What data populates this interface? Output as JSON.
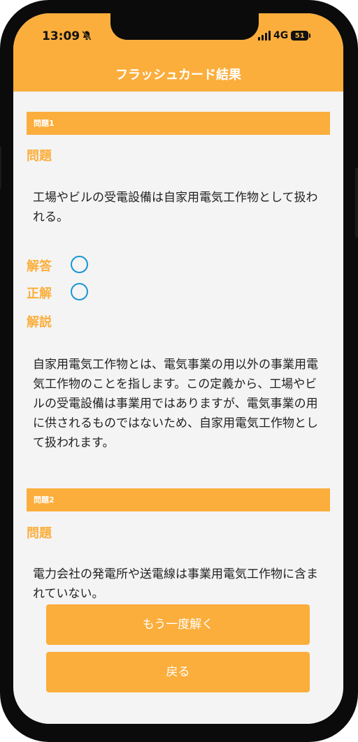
{
  "status_bar": {
    "time": "13:09",
    "network": "4G",
    "battery": "51"
  },
  "header": {
    "title": "フラッシュカード結果"
  },
  "questions": [
    {
      "header": "問題1",
      "question_label": "問題",
      "question_text": "工場やビルの受電設備は自家用電気工作物として扱われる。",
      "answer_label": "解答",
      "correct_label": "正解",
      "explanation_label": "解説",
      "explanation_text": "自家用電気工作物とは、電気事業の用以外の事業用電気工作物のことを指します。この定義から、工場やビルの受電設備は事業用ではありますが、電気事業の用に供されるものではないため、自家用電気工作物として扱われます。"
    },
    {
      "header": "問題2",
      "question_label": "問題",
      "question_text": "電力会社の発電所や送電線は事業用電気工作物に含まれていない。"
    }
  ],
  "buttons": {
    "retry": "もう一度解く",
    "back": "戻る"
  },
  "colors": {
    "accent": "#fbae3c",
    "mark": "#1a96d4"
  },
  "icons": {
    "silent": "bell-slash-icon",
    "answer_mark": "circle-icon",
    "correct_mark": "circle-icon"
  }
}
